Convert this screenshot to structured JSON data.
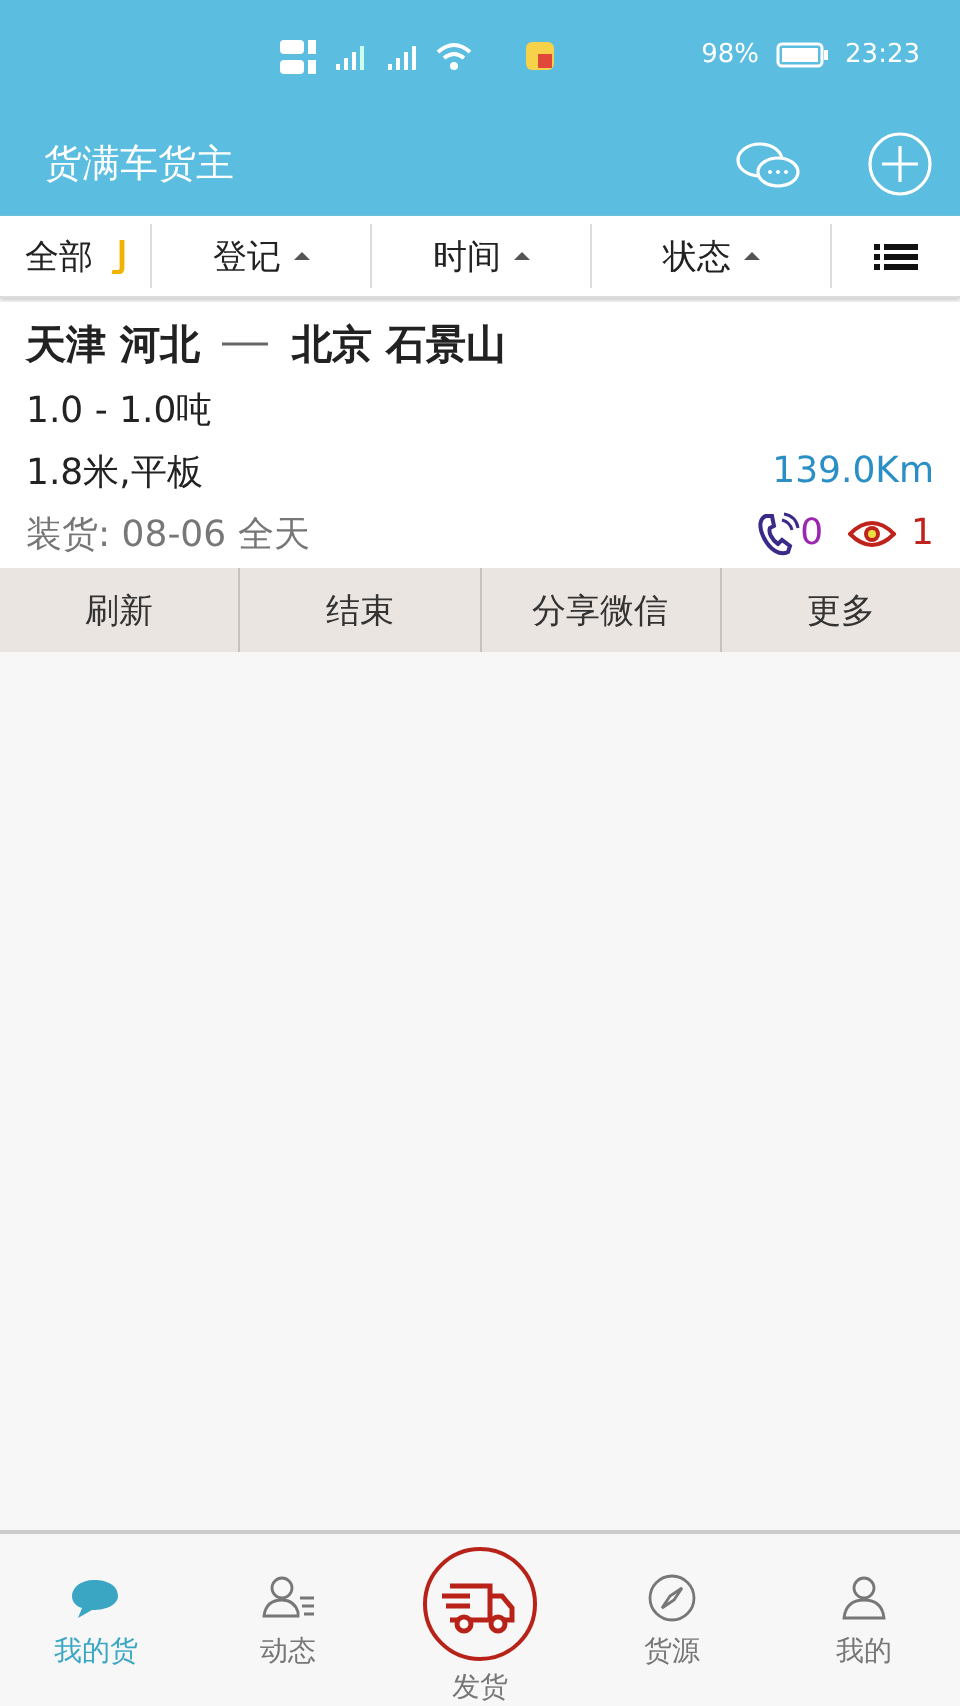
{
  "status_bar": {
    "battery": "98%",
    "time": "23:23"
  },
  "header": {
    "title": "货满车货主"
  },
  "filters": [
    {
      "label": "全部",
      "kind": "dropdown"
    },
    {
      "label": "登记",
      "kind": "sort"
    },
    {
      "label": "时间",
      "kind": "sort"
    },
    {
      "label": "状态",
      "kind": "sort"
    },
    {
      "kind": "menu"
    }
  ],
  "cargo": {
    "origin": "天津 河北",
    "destination": "北京 石景山",
    "weight": "1.0 - 1.0吨",
    "vehicle": "1.8米,平板",
    "distance": "139.0Km",
    "loading": "装货:  08-06 全天",
    "calls": "0",
    "views": "1"
  },
  "actions": [
    "刷新",
    "结束",
    "分享微信",
    "更多"
  ],
  "bottom_nav": [
    {
      "label": "我的货",
      "kind": "chat",
      "selected": true
    },
    {
      "label": "动态",
      "kind": "contacts",
      "selected": false
    },
    {
      "label": "发货",
      "kind": "truck",
      "selected": false
    },
    {
      "label": "货源",
      "kind": "compass",
      "selected": false
    },
    {
      "label": "我的",
      "kind": "person",
      "selected": false
    }
  ]
}
